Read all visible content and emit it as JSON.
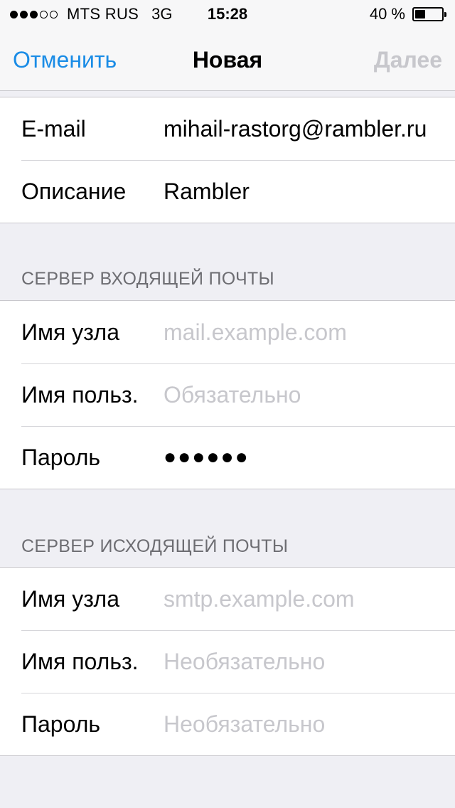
{
  "status_bar": {
    "signal_dots": [
      true,
      true,
      true,
      false,
      false
    ],
    "carrier": "MTS RUS",
    "network": "3G",
    "time": "15:28",
    "battery_percent": "40 %",
    "battery_level": 0.4
  },
  "nav": {
    "cancel_label": "Отменить",
    "title": "Новая",
    "next_label": "Далее"
  },
  "account": {
    "rows": [
      {
        "label": "E-mail",
        "value": "mihail-rastorg@rambler.ru"
      },
      {
        "label": "Описание",
        "value": "Rambler"
      }
    ]
  },
  "incoming": {
    "header": "СЕРВЕР ВХОДЯЩЕЙ ПОЧТЫ",
    "host": {
      "label": "Имя узла",
      "value": "",
      "placeholder": "mail.example.com"
    },
    "user": {
      "label": "Имя польз.",
      "value": "",
      "placeholder": "Обязательно"
    },
    "password": {
      "label": "Пароль",
      "value": "●●●●●●"
    }
  },
  "outgoing": {
    "header": "СЕРВЕР ИСХОДЯЩЕЙ ПОЧТЫ",
    "host": {
      "label": "Имя узла",
      "value": "",
      "placeholder": "smtp.example.com"
    },
    "user": {
      "label": "Имя польз.",
      "value": "",
      "placeholder": "Необязательно"
    },
    "password": {
      "label": "Пароль",
      "value": "",
      "placeholder": "Необязательно"
    }
  },
  "colors": {
    "accent": "#1a8ce6",
    "disabled": "#c7c7cc",
    "background": "#efeff4"
  }
}
